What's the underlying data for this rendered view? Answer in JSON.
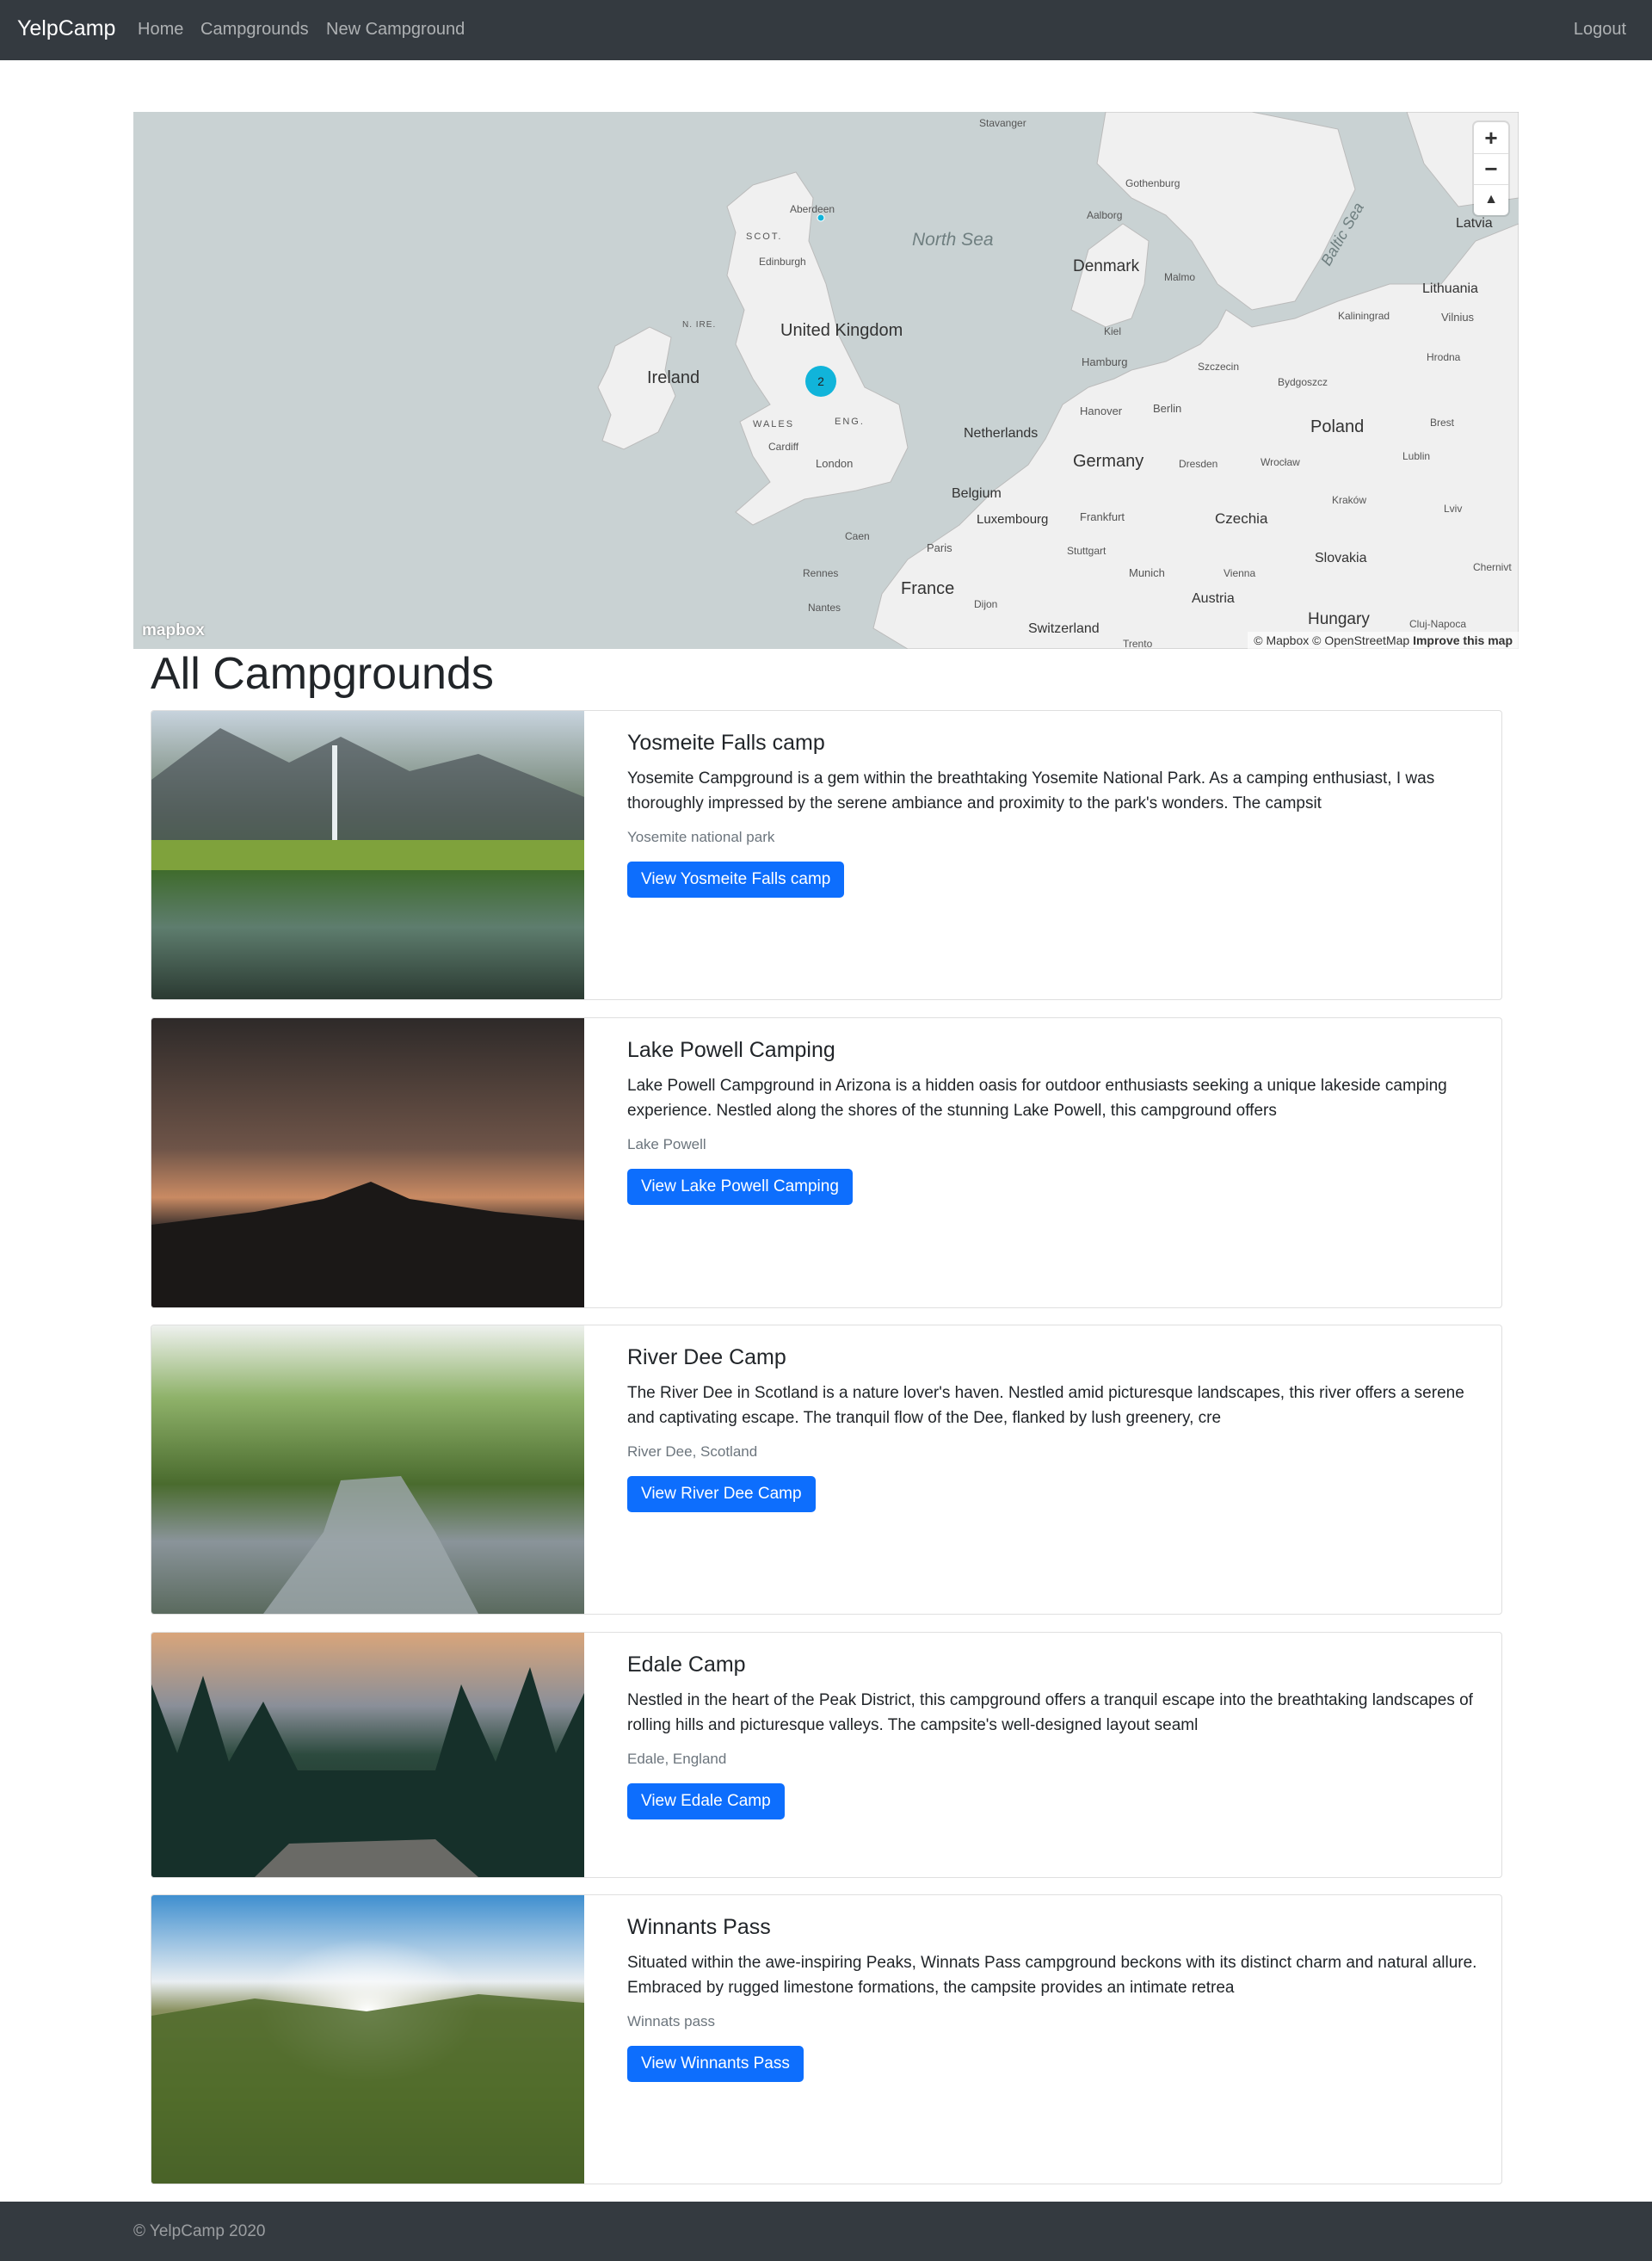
{
  "navbar": {
    "brand": "YelpCamp",
    "links": [
      "Home",
      "Campgrounds",
      "New Campground"
    ],
    "logout": "Logout"
  },
  "map": {
    "labels": {
      "north_sea": "North Sea",
      "baltic_sea": "Baltic Sea",
      "uk": "United Kingdom",
      "ireland": "Ireland",
      "denmark": "Denmark",
      "netherlands": "Netherlands",
      "belgium": "Belgium",
      "luxembourg": "Luxembourg",
      "germany": "Germany",
      "france": "France",
      "poland": "Poland",
      "czechia": "Czechia",
      "slovakia": "Slovakia",
      "austria": "Austria",
      "hungary": "Hungary",
      "switzerland": "Switzerland",
      "lithuania": "Lithuania",
      "latvia": "Latvia",
      "scot": "SCOT.",
      "wales": "WALES",
      "eng": "ENG.",
      "n_ire": "N. IRE.",
      "aberdeen": "Aberdeen",
      "edinburgh": "Edinburgh",
      "cardiff": "Cardiff",
      "london": "London",
      "paris": "Paris",
      "caen": "Caen",
      "rennes": "Rennes",
      "nantes": "Nantes",
      "dijon": "Dijon",
      "hamburg": "Hamburg",
      "hanover": "Hanover",
      "berlin": "Berlin",
      "kiel": "Kiel",
      "frankfurt": "Frankfurt",
      "stuttgart": "Stuttgart",
      "munich": "Munich",
      "dresden": "Dresden",
      "vienna": "Vienna",
      "malmo": "Malmo",
      "aalborg": "Aalborg",
      "gothenburg": "Gothenburg",
      "stavanger": "Stavanger",
      "szczecin": "Szczecin",
      "bydgoszcz": "Bydgoszcz",
      "kaliningrad": "Kaliningrad",
      "vilnius": "Vilnius",
      "hrodna": "Hrodna",
      "brest": "Brest",
      "lublin": "Lublin",
      "wroclaw": "Wrocław",
      "krakow": "Kraków",
      "lviv": "Lviv",
      "chernivtsi": "Chernivt",
      "cluj": "Cluj-Napoca",
      "trento": "Trento"
    },
    "cluster_count": "2",
    "controls": {
      "zoom_in": "+",
      "zoom_out": "−",
      "compass": "▲"
    },
    "logo": "mapbox",
    "attribution": "© Mapbox © OpenStreetMap",
    "improve": "Improve this map",
    "colors": {
      "water": "#c9d2d3",
      "land": "#f0f0f0",
      "cluster": "#11b4da",
      "point": "#11b4da"
    }
  },
  "page": {
    "title": "All Campgrounds"
  },
  "campgrounds": [
    {
      "title": "Yosmeite Falls camp",
      "description": "Yosemite Campground is a gem within the breathtaking Yosemite National Park. As a camping enthusiast, I was thoroughly impressed by the serene ambiance and proximity to the park's wonders. The campsit",
      "location": "Yosemite national park",
      "button": "View Yosmeite Falls camp"
    },
    {
      "title": "Lake Powell Camping",
      "description": "Lake Powell Campground in Arizona is a hidden oasis for outdoor enthusiasts seeking a unique lakeside camping experience. Nestled along the shores of the stunning Lake Powell, this campground offers",
      "location": "Lake Powell",
      "button": "View Lake Powell Camping"
    },
    {
      "title": "River Dee Camp",
      "description": "The River Dee in Scotland is a nature lover's haven. Nestled amid picturesque landscapes, this river offers a serene and captivating escape. The tranquil flow of the Dee, flanked by lush greenery, cre",
      "location": "River Dee, Scotland",
      "button": "View River Dee Camp"
    },
    {
      "title": "Edale Camp",
      "description": "Nestled in the heart of the Peak District, this campground offers a tranquil escape into the breathtaking landscapes of rolling hills and picturesque valleys. The campsite's well-designed layout seaml",
      "location": "Edale, England",
      "button": "View Edale Camp"
    },
    {
      "title": "Winnants Pass",
      "description": "Situated within the awe-inspiring Peaks, Winnats Pass campground beckons with its distinct charm and natural allure. Embraced by rugged limestone formations, the campsite provides an intimate retrea",
      "location": "Winnats pass",
      "button": "View Winnants Pass"
    }
  ],
  "footer": {
    "text": "© YelpCamp 2020"
  }
}
